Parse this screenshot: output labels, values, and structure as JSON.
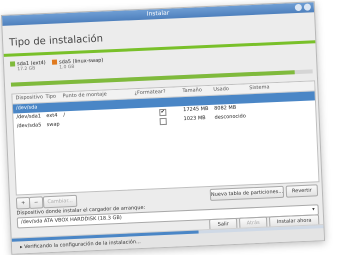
{
  "window": {
    "title": "Instalar"
  },
  "page": {
    "heading": "Tipo de instalación"
  },
  "colors": {
    "accent_green": "#79c02a",
    "selection_blue": "#4a86c6",
    "swap_orange": "#e07a1f",
    "ext4_green": "#7fba3c"
  },
  "partition_bar": {
    "legend": [
      {
        "name": "sda1 (ext4)",
        "size": "17.2 GB",
        "color": "#7fba3c"
      },
      {
        "name": "sda5 (linux-swap)",
        "size": "1.0 GB",
        "color": "#e07a1f"
      }
    ],
    "fill_fraction": 0.94
  },
  "table": {
    "columns": [
      "Dispositivo",
      "Tipo",
      "Punto de montaje",
      "¿Formatear?",
      "Tamaño",
      "Usado",
      "Sistema"
    ],
    "rows": [
      {
        "device": "/dev/sda",
        "type": "",
        "mount": "",
        "format": "",
        "size": "",
        "used": "",
        "system": ""
      },
      {
        "device": "/dev/sda1",
        "type": "ext4",
        "mount": "/",
        "format": "✔",
        "size": "17245 MB",
        "used": "8082 MB",
        "system": ""
      },
      {
        "device": "/dev/sda5",
        "type": "swap",
        "mount": "",
        "format": "",
        "size": "1023 MB",
        "used": "desconocido",
        "system": ""
      }
    ]
  },
  "buttons": {
    "add": "+",
    "remove": "−",
    "change": "Cambiar...",
    "new_table": "Nueva tabla de particiones...",
    "revert": "Revertir",
    "quit": "Salir",
    "back": "Atrás",
    "install_now": "Instalar ahora"
  },
  "bootloader": {
    "label": "Dispositivo donde instalar el cargador de arranque:",
    "value": "/dev/sda   ATA VBOX HARDDISK (18.3 GB)"
  },
  "footer": {
    "status": "Verificando la configuración de la instalación...",
    "progress": 0.6
  }
}
